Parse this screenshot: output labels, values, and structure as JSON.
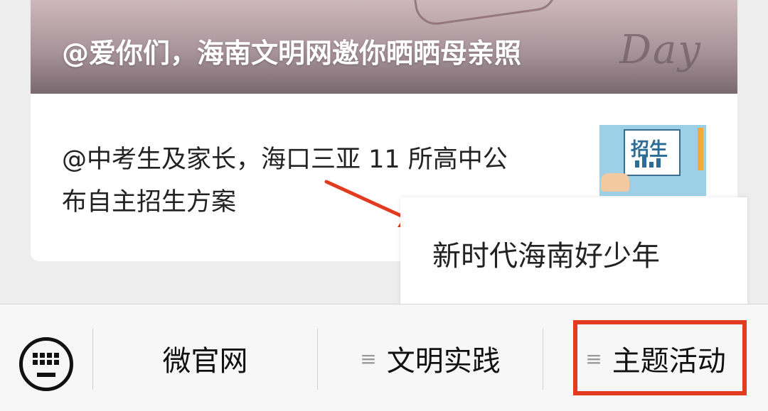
{
  "article": {
    "banner_title": "@爱你们，海南文明网邀你晒晒母亲照",
    "banner_script": "Day",
    "item_line1": "@中考生及家长，海口三亚 11 所高中公",
    "item_line2": "布自主招生方案",
    "thumb_label": "招生"
  },
  "popup": {
    "item": "新时代海南好少年"
  },
  "menubar": {
    "keyboard_icon": "keyboard-icon",
    "menus": [
      {
        "label": "微官网"
      },
      {
        "label": "文明实践",
        "icon": "≡"
      },
      {
        "label": "主题活动",
        "icon": "≡"
      }
    ]
  },
  "colors": {
    "highlight": "#e33b1f",
    "arrow": "#e33b1f",
    "background": "#ededed"
  }
}
